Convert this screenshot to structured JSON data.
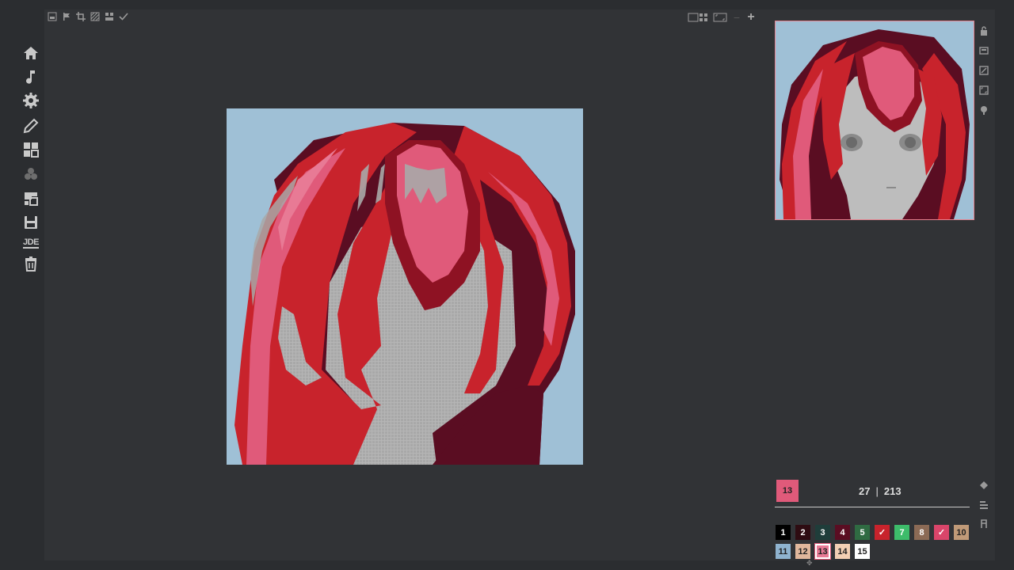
{
  "sidebar": {
    "items": [
      {
        "name": "home-icon"
      },
      {
        "name": "music-icon"
      },
      {
        "name": "settings-icon"
      },
      {
        "name": "pencil-icon"
      },
      {
        "name": "grid-icon"
      },
      {
        "name": "palette-icon"
      },
      {
        "name": "layers-icon"
      },
      {
        "name": "save-icon"
      },
      {
        "name": "jde-icon",
        "label": "JDE"
      },
      {
        "name": "trash-icon"
      }
    ]
  },
  "toolbar": {
    "left_tools": [
      "image-icon",
      "flag-icon",
      "crop-icon",
      "pattern-icon",
      "split-icon",
      "check-icon"
    ],
    "right_tools": [
      "layout-icon",
      "fit-icon",
      "zoom-out-icon",
      "zoom-in-icon"
    ],
    "zoom_out_label": "−",
    "zoom_in_label": "+"
  },
  "right_rail": [
    "lock-icon",
    "window-icon",
    "resize-icon",
    "fullscreen-icon",
    "bulb-icon"
  ],
  "current_color": {
    "number": "13",
    "hex": "#e05a7a"
  },
  "counter": {
    "current": "27",
    "separator": "|",
    "total": "213"
  },
  "palette": [
    {
      "label": "1",
      "hex": "#000000",
      "text": "#ffffff"
    },
    {
      "label": "2",
      "hex": "#2e0c12",
      "text": "#ffffff"
    },
    {
      "label": "3",
      "hex": "#1f3d3a",
      "text": "#ffffff"
    },
    {
      "label": "4",
      "hex": "#5a0d22",
      "text": "#ffffff"
    },
    {
      "label": "5",
      "hex": "#2f6b42",
      "text": "#ffffff"
    },
    {
      "label": "✓",
      "hex": "#c8232c",
      "text": "#ffffff"
    },
    {
      "label": "7",
      "hex": "#3dbc6a",
      "text": "#ffffff"
    },
    {
      "label": "8",
      "hex": "#8b6a55",
      "text": "#ffffff"
    },
    {
      "label": "✓",
      "hex": "#d9456a",
      "text": "#ffffff"
    },
    {
      "label": "10",
      "hex": "#c09a78",
      "text": "#222222"
    },
    {
      "label": "11",
      "hex": "#8fb3cf",
      "text": "#222222"
    },
    {
      "label": "12",
      "hex": "#e0b79c",
      "text": "#222222"
    },
    {
      "label": "13",
      "hex": "#e87a95",
      "text": "#222222",
      "selected": true
    },
    {
      "label": "14",
      "hex": "#f2cfb4",
      "text": "#222222"
    },
    {
      "label": "15",
      "hex": "#ffffff",
      "text": "#222222"
    }
  ],
  "bottom_rail": [
    "fill-icon",
    "align-icon",
    "anchor-icon"
  ],
  "colors": {
    "sky": "#9fc0d6",
    "hair_dark": "#5a0d22",
    "hair_mid": "#c8232c",
    "hair_light": "#e05a7a",
    "hair_shadow": "#8e1223",
    "face_grey": "#b3b3b3"
  }
}
